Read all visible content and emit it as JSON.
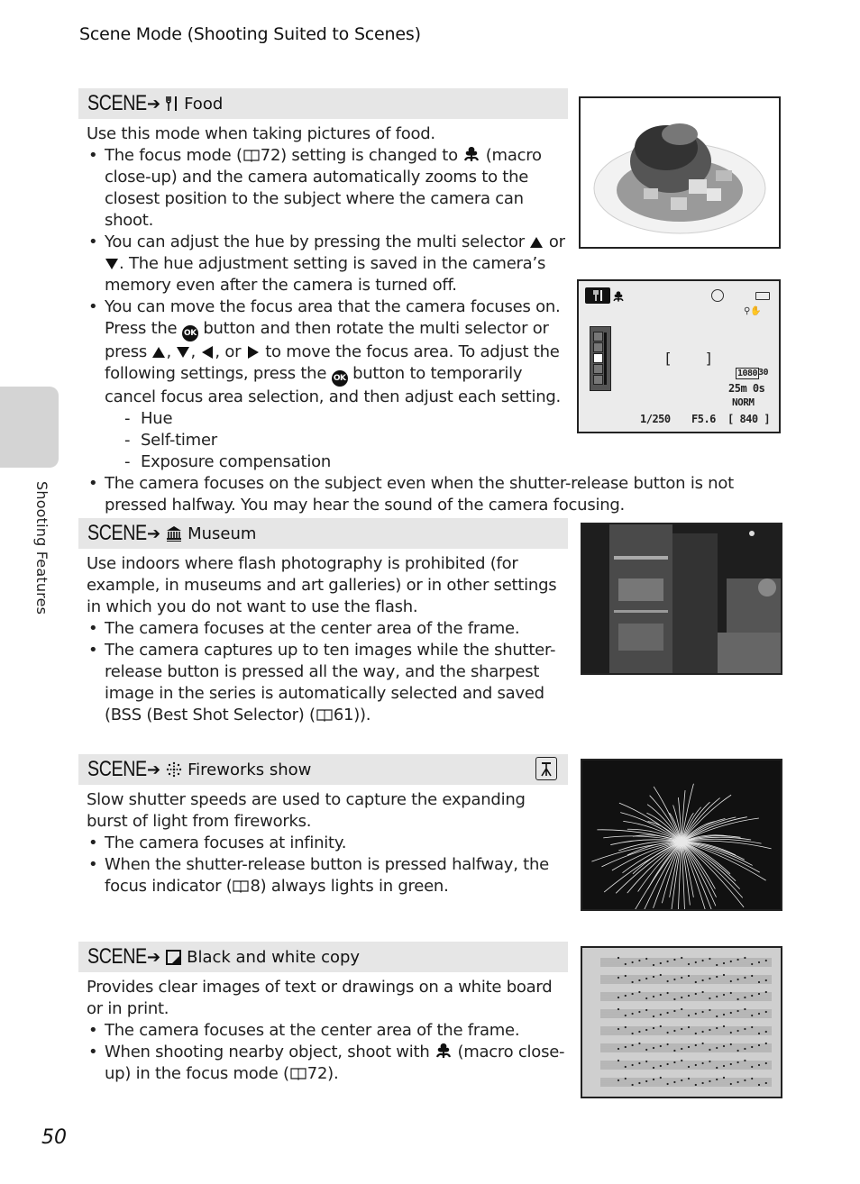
{
  "header": {
    "title": "Scene Mode (Shooting Suited to Scenes)"
  },
  "side_tab": {
    "label": "Shooting Features"
  },
  "page_number": "50",
  "scene_word": "SCENE",
  "arrow": "➔",
  "sections": [
    {
      "icon": "food-icon",
      "name": "Food",
      "intro": "Use this mode when taking pictures of food.",
      "bullets": [
        {
          "parts": [
            "The focus mode (",
            "72) setting is changed to ",
            " (macro close-up) and the camera automatically zooms to the closest position to the subject where the camera can shoot."
          ]
        },
        {
          "parts": [
            "You can adjust the hue by pressing the multi selector ",
            " or ",
            ". The hue adjustment setting is saved in the camera’s memory even after the camera is turned off."
          ]
        },
        {
          "parts": [
            "You can move the focus area that the camera focuses on. Press the ",
            " button and then rotate the multi selector or press ",
            ", ",
            ", ",
            ", or ",
            " to move the focus area. To adjust the following settings, press the ",
            " button to temporarily cancel focus area selection, and then adjust each setting."
          ]
        },
        {
          "text": "The camera focuses on the subject even when the shutter-release button is not pressed halfway. You may hear the sound of the camera focusing."
        }
      ],
      "sub_items": [
        "Hue",
        "Self-timer",
        "Exposure compensation"
      ],
      "image": "food-photo"
    },
    {
      "icon": "museum-icon",
      "name": "Museum",
      "intro": "Use indoors where flash photography is prohibited (for example, in museums and art galleries) or in other settings in which you do not want to use the flash.",
      "bullets": [
        {
          "text": "The camera focuses at the center area of the frame."
        },
        {
          "parts": [
            "The camera captures up to ten images while the shutter-release button is pressed all the way, and the sharpest image in the series is automatically selected and saved (BSS (Best Shot Selector) (",
            "61))."
          ]
        }
      ],
      "image": "museum-photo"
    },
    {
      "icon": "fireworks-icon",
      "name": "Fireworks show",
      "badge": "tripod-icon",
      "intro": "Slow shutter speeds are used to capture the expanding burst of light from fireworks.",
      "bullets": [
        {
          "text": "The camera focuses at infinity."
        },
        {
          "parts": [
            "When the shutter-release button is pressed halfway, the focus indicator (",
            "8) always lights in green."
          ]
        }
      ],
      "image": "fireworks-photo"
    },
    {
      "icon": "copy-icon",
      "name": "Black and white copy",
      "intro": "Provides clear images of text or drawings on a white board or in print.",
      "bullets": [
        {
          "text": "The camera focuses at the center area of the frame."
        },
        {
          "parts": [
            "When shooting nearby object, shoot with ",
            " (macro close-up) in the focus mode (",
            "72)."
          ]
        }
      ],
      "image": "sheet-music-photo"
    }
  ],
  "lcd": {
    "shutter": "1/250",
    "aperture": "F5.6",
    "exposures": "840",
    "video_size": "1080",
    "frame_rate": "30",
    "rec_time": "25m 0s",
    "quality": "NORM",
    "hue_level": 3,
    "hue_steps": 5
  }
}
